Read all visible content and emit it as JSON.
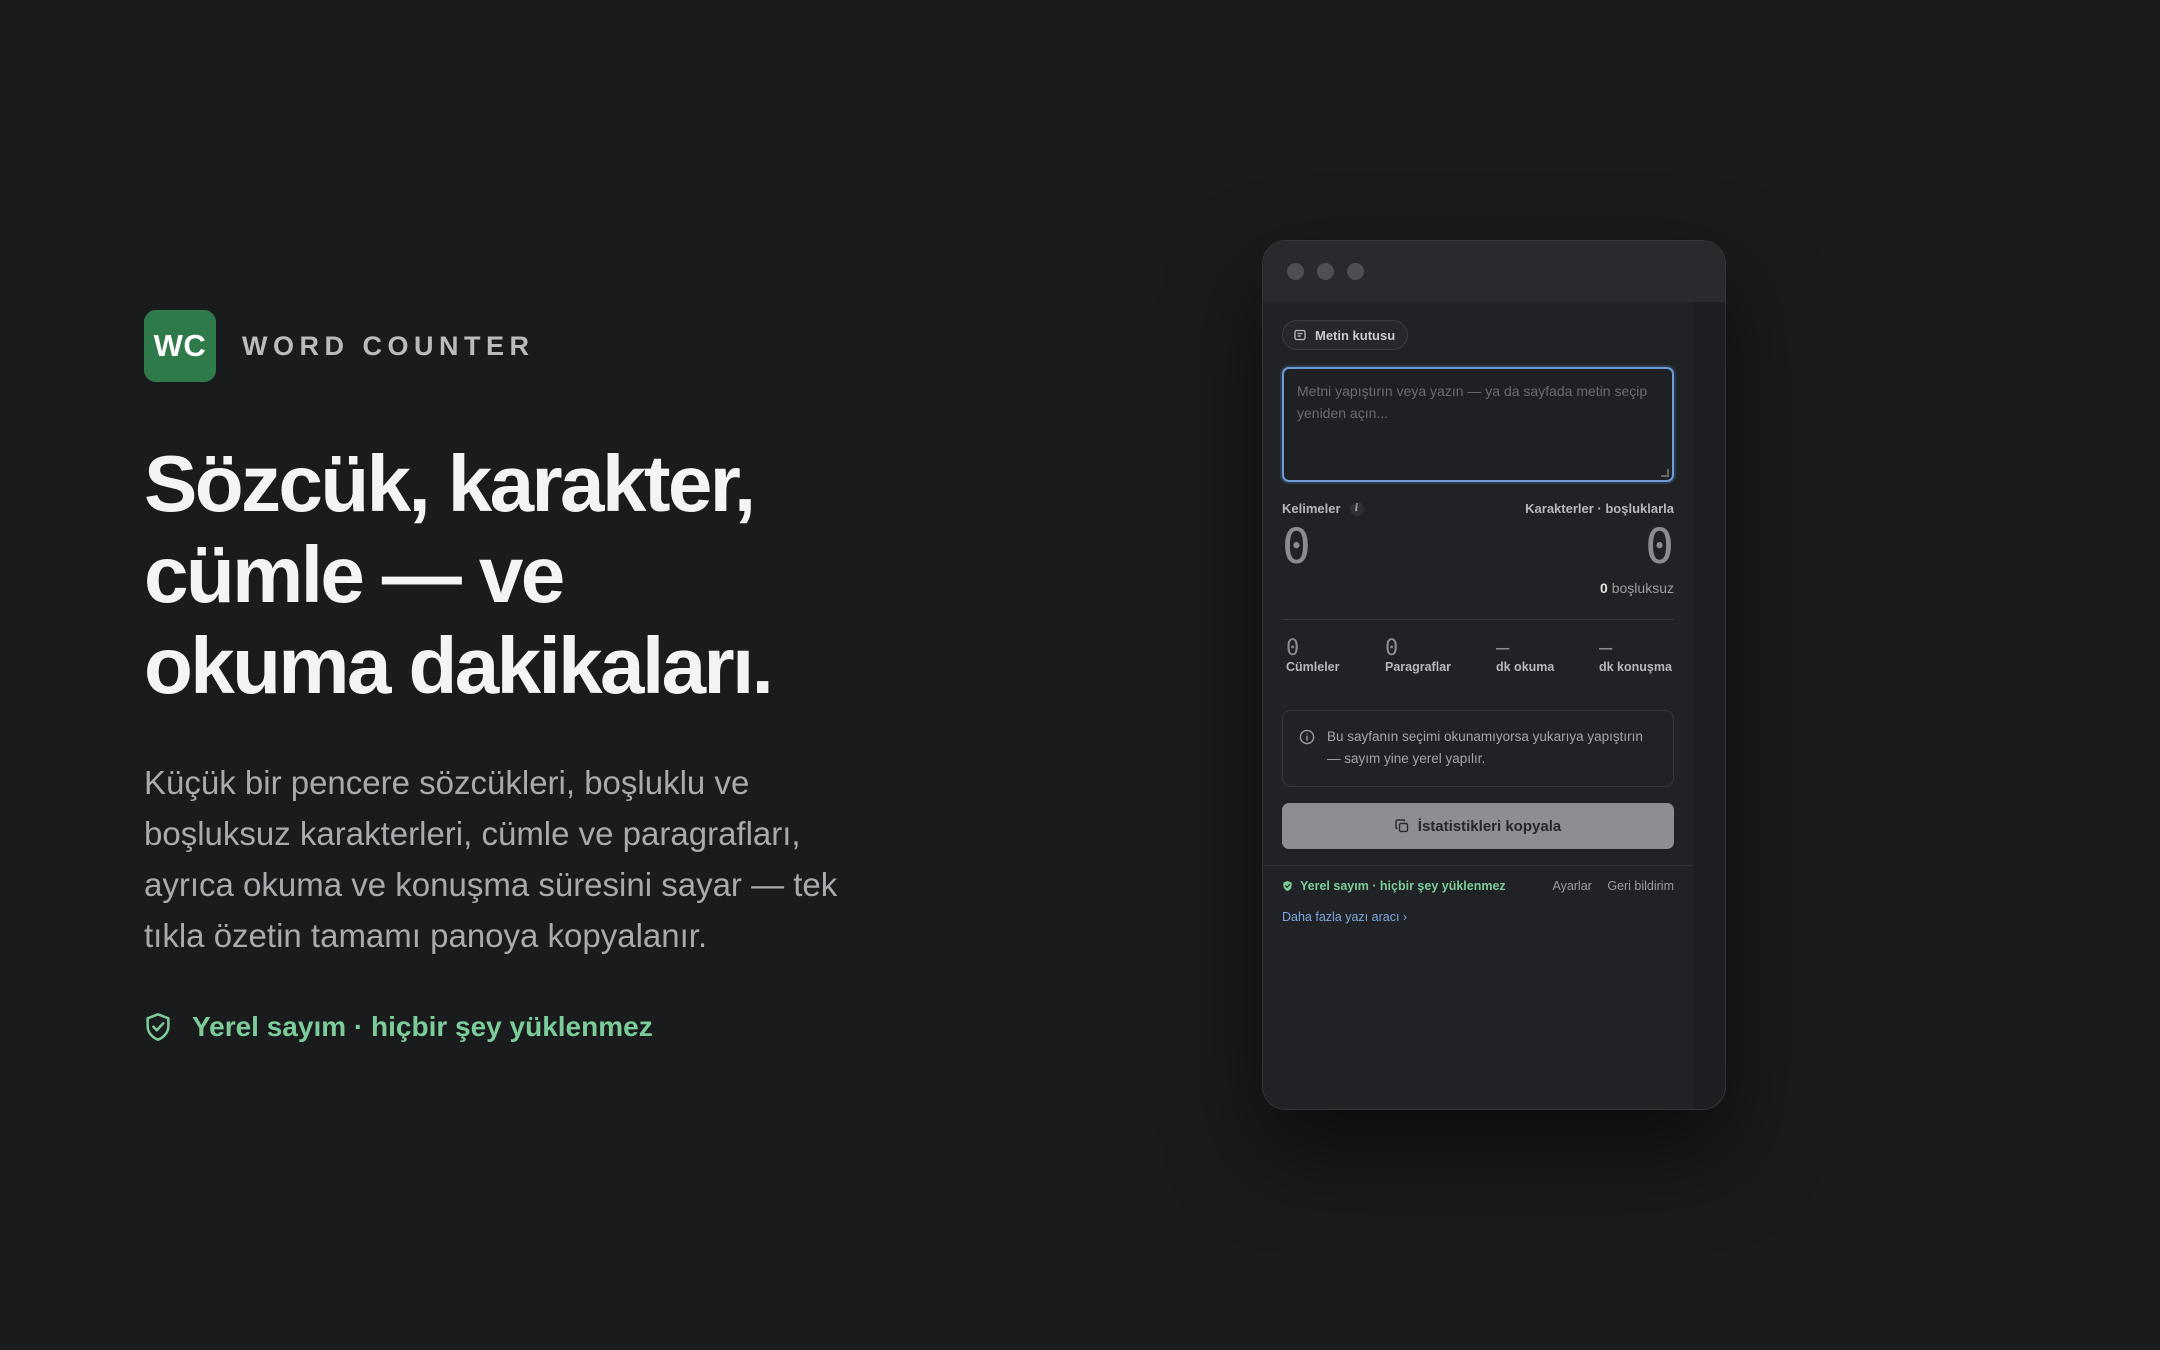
{
  "brand": {
    "logo_text": "WC",
    "name": "WORD COUNTER"
  },
  "hero": {
    "headline_lines": [
      "Sözcük, karakter,",
      "cümle — ve",
      "okuma dakikaları."
    ],
    "lead_lines": [
      "Küçük bir pencere sözcükleri, boşluklu ve",
      "boşluksuz karakterleri, cümle ve paragrafları,",
      "ayrıca okuma ve konuşma süresini sayar — tek",
      "tıkla özetin tamamı panoya kopyalanır."
    ],
    "privacy_label": "Yerel sayım · hiçbir şey yüklenmez"
  },
  "app": {
    "source_chip": "Metin kutusu",
    "textarea": {
      "value": "",
      "placeholder": "Metni yapıştırın veya yazın — ya da sayfada metin seçip yeniden açın..."
    },
    "words": {
      "label": "Kelimeler",
      "value": "0",
      "info": "i"
    },
    "chars": {
      "label": "Karakterler · boşluklarla",
      "value": "0",
      "no_space_value": "0",
      "no_space_label": "boşluksuz"
    },
    "mini_stats": [
      {
        "value": "0",
        "label": "Cümleler"
      },
      {
        "value": "0",
        "label": "Paragraflar"
      },
      {
        "value": "—",
        "label": "dk okuma"
      },
      {
        "value": "—",
        "label": "dk konuşma"
      }
    ],
    "notice_lines": [
      "Bu sayfanın seçimi okunamıyorsa yukarıya yapıştırın",
      "— sayım yine yerel yapılır."
    ],
    "copy_button": "İstatistikleri kopyala",
    "footer": {
      "local_label": "Yerel sayım · hiçbir şey yüklenmez",
      "settings": "Ayarlar",
      "feedback": "Geri bildirim",
      "more_tools": "Daha fazla yazı aracı ›"
    }
  },
  "colors": {
    "background": "#1a1b1d",
    "brand_green": "#2f7a4b",
    "accent_green": "#7ccc9a",
    "focus_blue": "#6f9bd3",
    "link_blue": "#7aa8de"
  }
}
